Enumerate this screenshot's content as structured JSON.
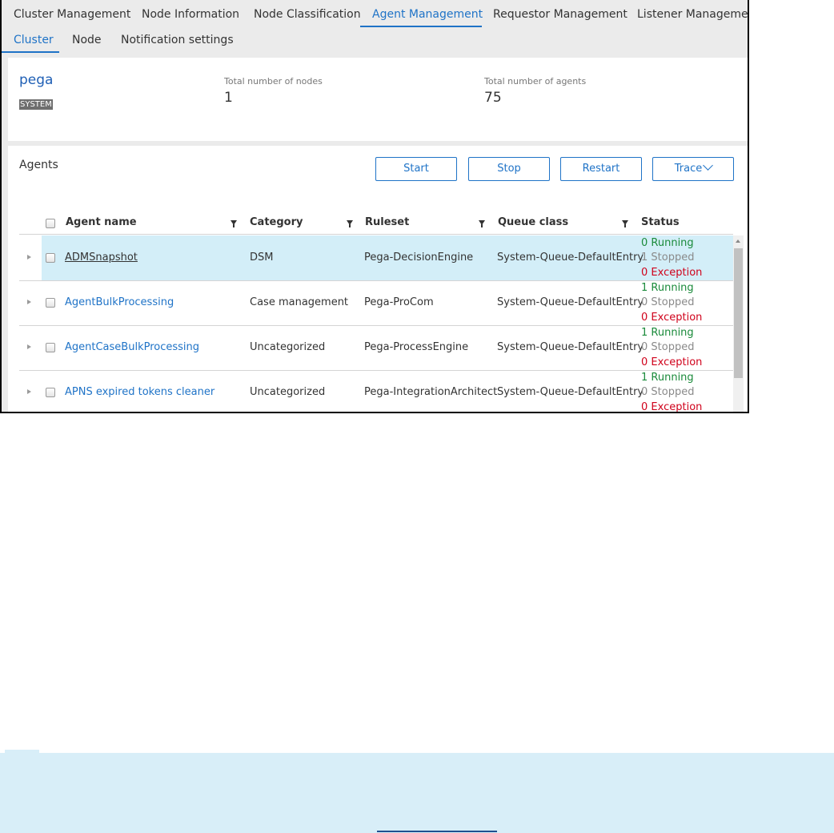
{
  "tabs": [
    "Cluster Management",
    "Node Information",
    "Node Classification",
    "Agent Management",
    "Requestor Management",
    "Listener Management"
  ],
  "active_tab": "Agent Management",
  "subtabs": [
    "Cluster",
    "Node",
    "Notification settings"
  ],
  "active_subtab": "Cluster",
  "summary": {
    "cluster_name": "pega",
    "badge": "SYSTEM",
    "nodes_label": "Total number of nodes",
    "nodes_value": "1",
    "agents_label": "Total number of agents",
    "agents_value": "75"
  },
  "agents_panel": {
    "title": "Agents",
    "buttons": {
      "start": "Start",
      "stop": "Stop",
      "restart": "Restart",
      "trace": "Trace"
    }
  },
  "grid": {
    "columns": [
      "Agent name",
      "Category",
      "Ruleset",
      "Queue class",
      "Status"
    ],
    "rows": [
      {
        "name": "ADMSnapshot",
        "category": "DSM",
        "ruleset": "Pega-DecisionEngine",
        "queue_class": "System-Queue-DefaultEntry",
        "running": "0 Running",
        "stopped": "1 Stopped",
        "exception": "0 Exception",
        "selected": true
      },
      {
        "name": "AgentBulkProcessing",
        "category": "Case management",
        "ruleset": "Pega-ProCom",
        "queue_class": "System-Queue-DefaultEntry",
        "running": "1 Running",
        "stopped": "0 Stopped",
        "exception": "0 Exception",
        "selected": false
      },
      {
        "name": "AgentCaseBulkProcessing",
        "category": "Uncategorized",
        "ruleset": "Pega-ProcessEngine",
        "queue_class": "System-Queue-DefaultEntry",
        "running": "1 Running",
        "stopped": "0 Stopped",
        "exception": "0 Exception",
        "selected": false
      },
      {
        "name": "APNS expired tokens cleaner",
        "category": "Uncategorized",
        "ruleset": "Pega-IntegrationArchitect",
        "queue_class": "System-Queue-DefaultEntry",
        "running": "1 Running",
        "stopped": "0 Stopped",
        "exception": "0 Exception",
        "selected": false
      }
    ]
  },
  "colors": {
    "accent": "#1f73c7",
    "selected_row": "#d3eef8",
    "running": "#1a8a3a",
    "stopped": "#8a8a8a",
    "exception": "#d0021b"
  }
}
